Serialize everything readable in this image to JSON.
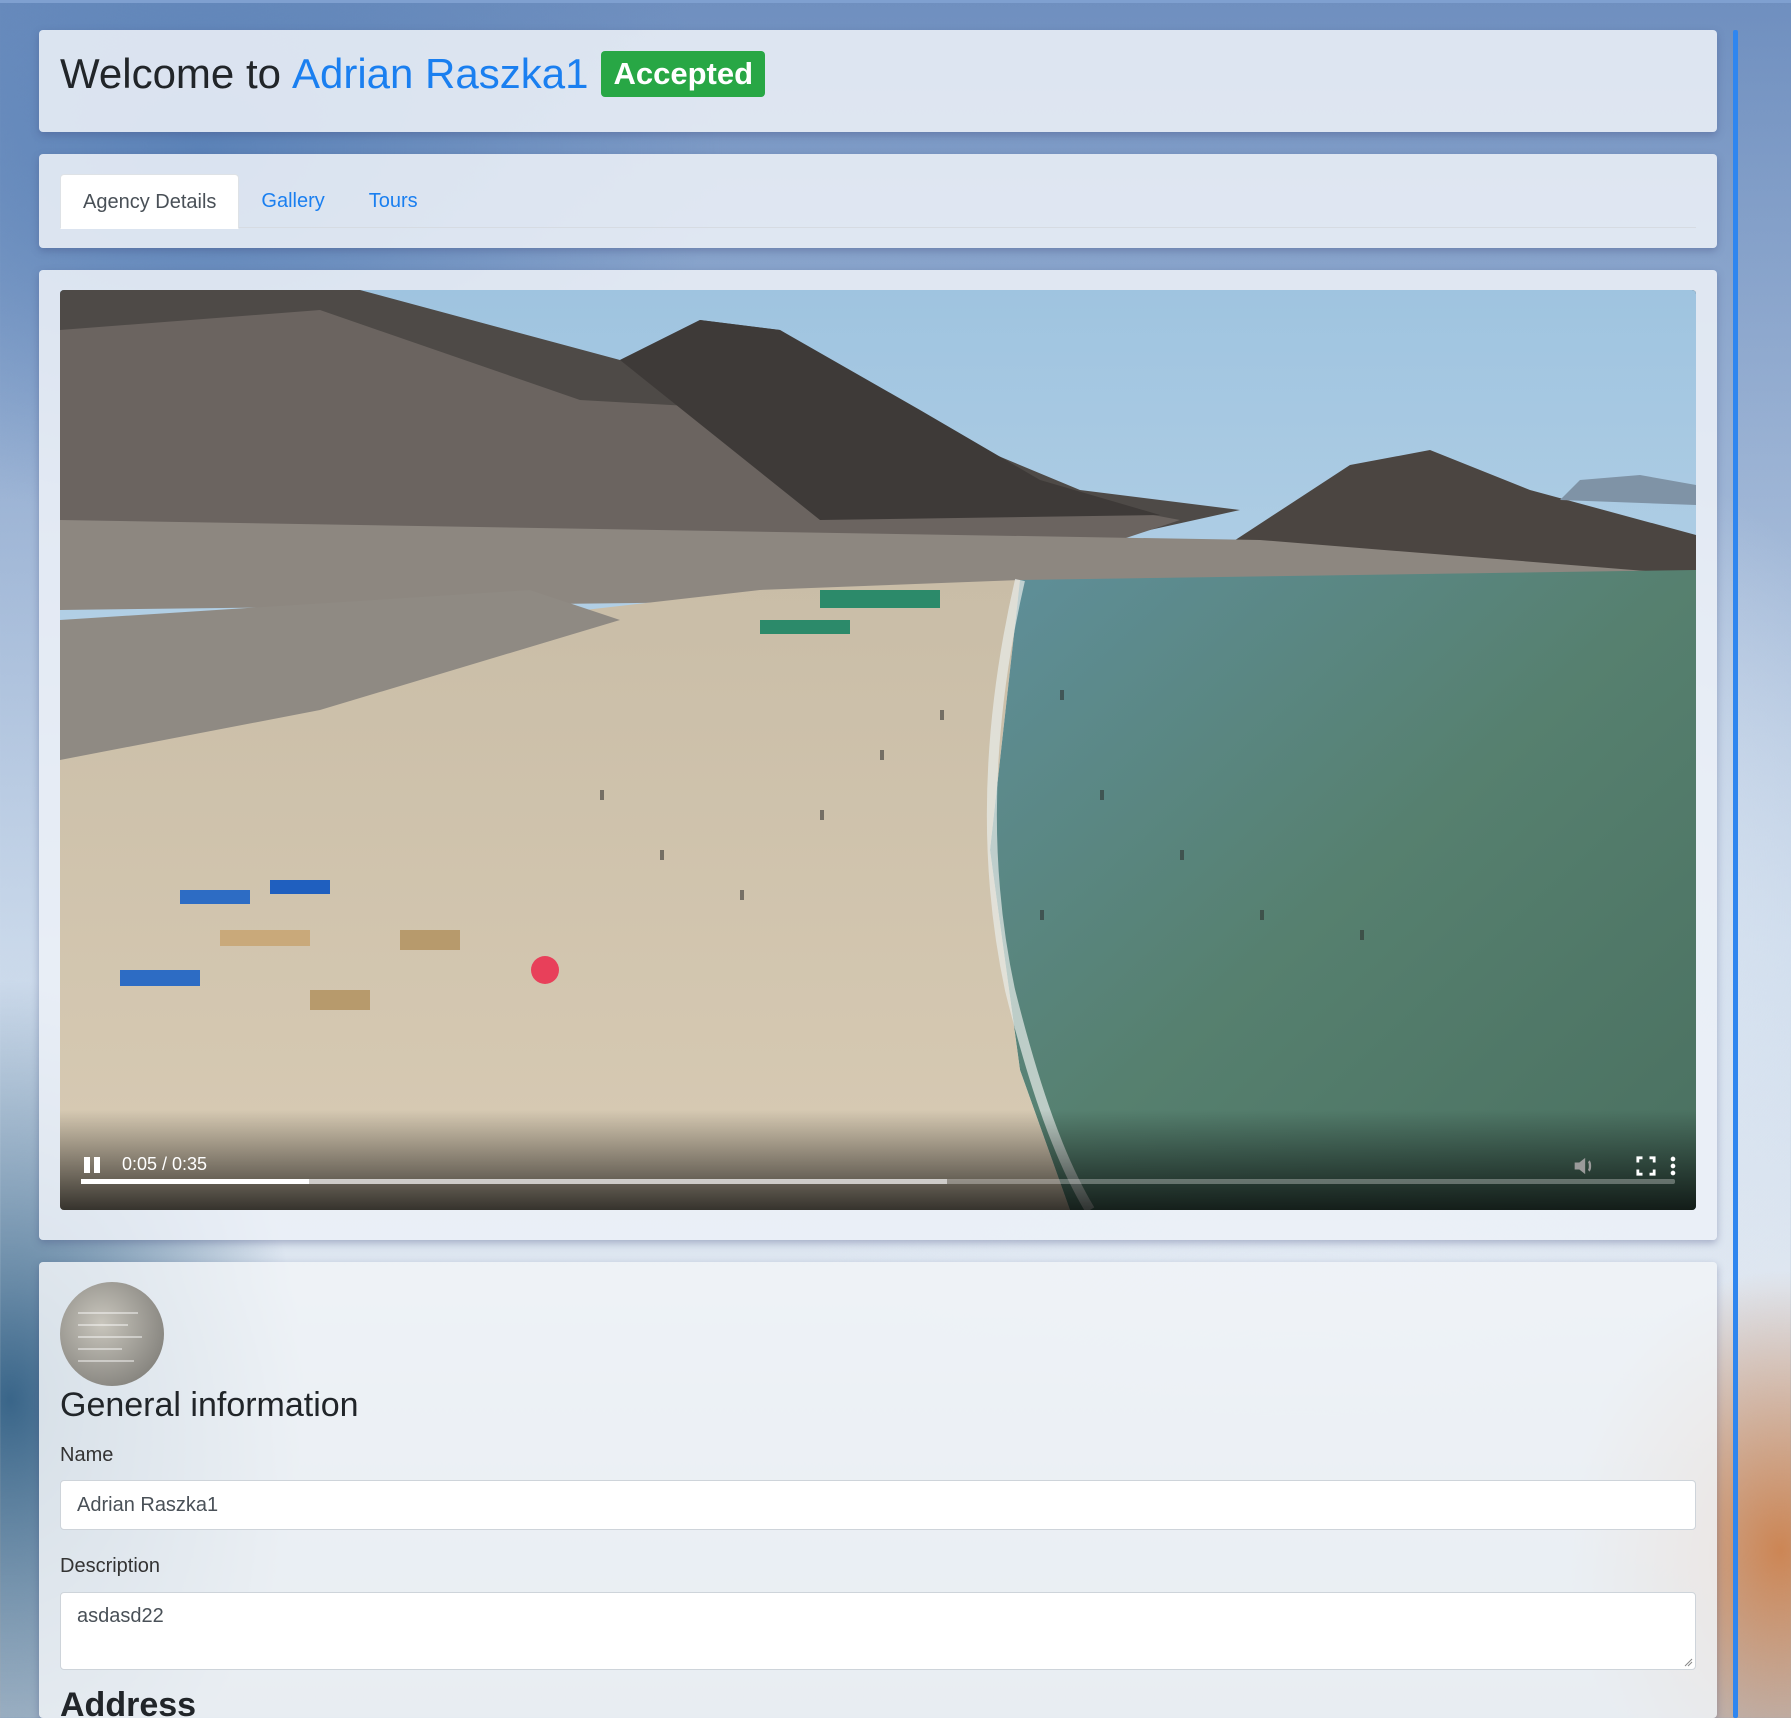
{
  "header": {
    "welcome_prefix": "Welcome to",
    "agency_name": "Adrian Raszka1",
    "status": "Accepted",
    "status_color": "#28a745",
    "accent_color": "#1a7ff0"
  },
  "tabs": [
    {
      "label": "Agency Details",
      "active": true
    },
    {
      "label": "Gallery",
      "active": false
    },
    {
      "label": "Tours",
      "active": false
    }
  ],
  "video": {
    "time": "0:05 / 0:35",
    "state": "playing",
    "progress": 0.143,
    "buffered": 0.543,
    "controls": [
      "pause-icon",
      "volume-icon",
      "fullscreen-icon",
      "more-options-icon"
    ]
  },
  "general_info": {
    "title": "General information",
    "name_label": "Name",
    "name_value": "Adrian Raszka1",
    "description_label": "Description",
    "description_value": "asdasd22",
    "next_section_title": "Address"
  }
}
